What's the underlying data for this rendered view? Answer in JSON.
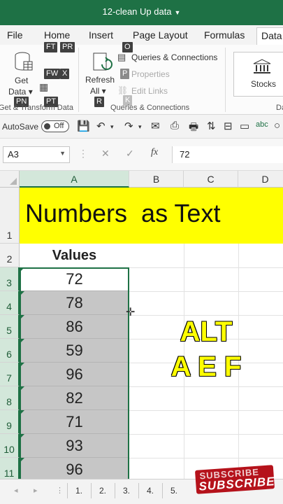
{
  "window": {
    "title": "12-clean Up data"
  },
  "menu": {
    "tabs": [
      "File",
      "Home",
      "Insert",
      "Page Layout",
      "Formulas",
      "Data"
    ],
    "active": "Data"
  },
  "ribbon": {
    "get_data": [
      "Get",
      "Data"
    ],
    "refresh_all": [
      "Refresh",
      "All"
    ],
    "queries_connections": "Queries & Connections",
    "properties": "Properties",
    "edit_links": "Edit Links",
    "stocks": "Stocks",
    "group_get_transform": "Get & Transform Data",
    "group_queries": "Queries & Connections",
    "group_data_types": "Da",
    "keytips": {
      "ft": "FT",
      "pr": "PR",
      "o": "O",
      "fw": "FW",
      "x": "X",
      "p": "P",
      "k": "K",
      "r": "R",
      "pn": "PN",
      "pt": "PT"
    }
  },
  "qat": {
    "autosave_label": "AutoSave",
    "autosave_state": "Off"
  },
  "formula_bar": {
    "name_box": "A3",
    "fx": "fx",
    "formula": "72"
  },
  "grid": {
    "columns": [
      "A",
      "B",
      "C",
      "D"
    ],
    "selected_column": "A",
    "rows": [
      "1",
      "2",
      "3",
      "4",
      "5",
      "6",
      "7",
      "8",
      "9",
      "10",
      "11"
    ],
    "title_text": "Numbers  as Text",
    "values_header": "Values",
    "values": [
      "72",
      "78",
      "86",
      "59",
      "96",
      "82",
      "71",
      "93",
      "96"
    ],
    "overlay_text": [
      "ALT",
      "A E F"
    ]
  },
  "sheets": [
    "1.",
    "2.",
    "3.",
    "4.",
    "5."
  ],
  "badge": {
    "line1": "SUBSCRIBE",
    "line2": "SUBSCRIBE"
  },
  "colors": {
    "excel_green": "#1e7145",
    "highlight_yellow": "#ffff00",
    "selection_gray": "#c6c6c6",
    "badge_red": "#b5121b"
  }
}
